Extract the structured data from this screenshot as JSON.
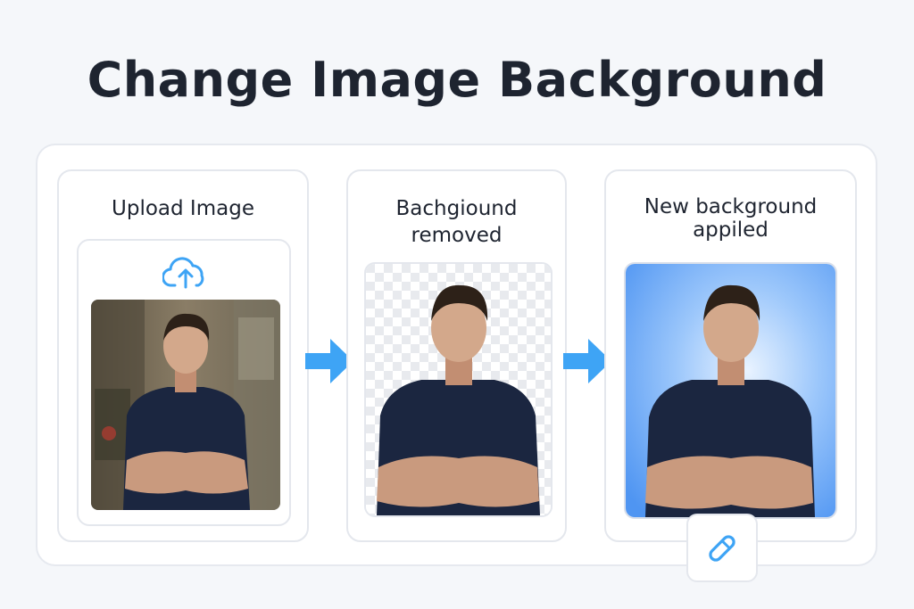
{
  "header": {
    "title": "Change Image Background"
  },
  "steps": [
    {
      "title": "Upload Image"
    },
    {
      "title_line1": "Bachgiound",
      "title_line2": "removed"
    },
    {
      "title_line1": "New background",
      "title_line2": "appiled"
    }
  ],
  "icons": {
    "upload": "upload-cloud-icon",
    "arrow": "arrow-right-icon",
    "edit": "pencil-icon"
  },
  "colors": {
    "accent": "#3ea4f5",
    "new_bg_light": "#e9f3ff",
    "new_bg_dark": "#4f95f2",
    "shirt": "#1b2640"
  }
}
